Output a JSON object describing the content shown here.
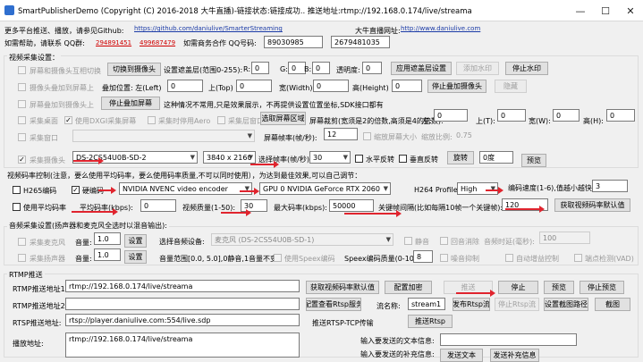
{
  "window": {
    "title": "SmartPublisherDemo  (Copyright (C) 2016-2018 大牛直播)-链接状态:链接成功.. 推送地址:rtmp://192.168.0.174/live/streama"
  },
  "header": {
    "tip": "更多平台推送、播放，请参见Github:",
    "github_url": "https://github.com/daniulive/SmarterStreaming",
    "website_label": "大牛直播网址:",
    "website_url": "http://www.daniulive.com",
    "help_label": "如需帮助，请联系 QQ群:",
    "qq_group1": "294891451",
    "qq_group2": "499687479",
    "biz_label": "如需商务合作 QQ号码:",
    "biz_qq1": "89030985",
    "biz_qq2": "2679481035"
  },
  "video": {
    "section": "视频采集设置：",
    "screen_camera_overlay": "屏幕和摄像头互相切换",
    "switch_camera": "切换到摄像头",
    "bg_color_label": "设置遮盖层(范围0-255):",
    "r": "R:",
    "r_val": "0",
    "g": "G:",
    "g_val": "0",
    "b": "B:",
    "b_val": "0",
    "alpha": "透明度:",
    "alpha_val": "0",
    "apply_cover": "应用遮盖层设置",
    "add_watermark": "添加水印",
    "stop_watermark": "停止水印",
    "camera_over_screen": "摄像头叠加到屏幕上",
    "overlay_pos": "叠加位置: 左(Left)",
    "left_val": "0",
    "top_label": "上(Top)",
    "top_val": "0",
    "width_label": "宽(Width)",
    "width_val": "0",
    "height_label": "高(Height)",
    "height_val": "0",
    "stop_overlay_camera": "停止叠加摄像头",
    "hide": "隐藏",
    "screen_over_camera": "屏幕叠加到摄像头上",
    "stop_overlay_screen": "停止叠加屏幕",
    "tip2": "这种情况不常用,只是效果展示，不再提供设置位置坐标,SDK接口都有",
    "capture_desktop": "采集桌面",
    "use_dxgi": "使用DXGI采集屏幕",
    "disable_aero": "采集时停用Aero",
    "capture_layer": "采集层窗口",
    "select_region": "选取屏幕区域",
    "screen_crop": "屏幕裁剪(宽须是2的倍数,高须是4的倍数):",
    "crop_left": "左:",
    "crop_left_val": "0",
    "crop_top": "上(T):",
    "crop_top_val": "0",
    "crop_w": "宽(W):",
    "crop_w_val": "0",
    "crop_h": "高(H):",
    "crop_h_val": "0",
    "capture_window": "采集窗口",
    "window_sel": "",
    "fps_label": "屏幕帧率(帧/秒):",
    "fps_val": "12",
    "scale_screen": "缩放屏幕大小",
    "scale_ratio": "缩放比例:",
    "scale_val": "0.75",
    "capture_camera": "采集摄像头",
    "camera_name": "DS-2CS54U0B-SD-2",
    "resolution": "3840 x 2160",
    "cam_fps_label": "选择帧率(帧/秒):",
    "cam_fps_val": "30",
    "hflip": "水平反转",
    "vflip": "垂直反转",
    "rotate": "旋转",
    "rotate_val": "0度",
    "preview": "预览"
  },
  "encode": {
    "section": "视频码率控制(注意，要么使用平均码率，要么使用码率质量,不可以同时使用），为达到最佳效果,可以自己调节：",
    "h265": "H265编码",
    "hw_encode": "硬编码",
    "encoder": "NVIDIA NVENC video encoder",
    "gpu": "GPU 0 NVIDIA GeForce RTX 2060",
    "profile_label": "H264 Profile:",
    "profile_val": "High",
    "speed_label": "编码速度(1-6),值越小越快",
    "speed_val": "3",
    "avg_bitrate": "使用平均码率",
    "avg_label": "平均码率(kbps):",
    "avg_val": "0",
    "quality_label": "视频质量(1-50):",
    "quality_val": "30",
    "max_label": "最大码率(kbps):",
    "max_val": "50000",
    "gop_label": "关键帧间隔(比如每隔10帧一个关键帧):",
    "gop_val": "120",
    "get_default": "获取视频码率默认值"
  },
  "audio": {
    "section": "音频采集设置(扬声器和麦克风全选时以混音输出):",
    "capture_speaker": "采集麦克风",
    "gain_label": "音量:",
    "gain_val": "1.0",
    "set": "设置",
    "select_device": "选择音频设备:",
    "device": "麦克风 (DS-2CS54U0B-SD-1)",
    "mute": "静音",
    "echo_cancel": "回音消除",
    "echo_delay": "音频时延(毫秒):",
    "echo_delay_val": "100",
    "capture_loopback": "采集扬声器",
    "gain2_val": "1.0",
    "set2": "设置",
    "vol_range": "音量范围[0.0, 5.0],0静音,1音量不变",
    "use_speex": "使用Speex编码",
    "speex_label": "Speex编码质量(0-10):",
    "speex_val": "8",
    "noise": "噪音抑制",
    "agc": "自动增益控制",
    "vad": "端点检测(VAD)"
  },
  "rtmp": {
    "section": "RTMP推送",
    "url1_label": "RTMP推送地址1:",
    "url1": "rtmp://192.168.0.174/live/streama",
    "get_bitrate": "获取视频码率默认值",
    "encrypt": "配置加密",
    "push": "推送",
    "stop": "停止",
    "preview": "预览",
    "stop_preview": "停止预览",
    "url2_label": "RTMP推送地址2:",
    "url2": "",
    "rtsp_config": "配置查看Rtsp服务",
    "stream_name_label": "流名称:",
    "stream_name": "stream1",
    "publish_rtsp": "发布Rtsp流",
    "stop_rtsp": "停止Rtsp流",
    "set_snapshot": "设置截图路径",
    "snapshot": "截图",
    "rtsp_label": "RTSP推送地址:",
    "rtsp_url": "rtsp://player.daniulive.com:554/live.sdp",
    "push_rtsp_tcp": "推送RTSP-TCP传输",
    "push_rtsp": "推送Rtsp",
    "play_label": "播放地址:",
    "play_url": "rtmp://192.168.0.174/live/streama",
    "text_input_label": "输入要发送的文本信息:",
    "text_label2": "输入要发送的补充信息:",
    "send_text": "发送文本",
    "send_info": "发送补充信息"
  }
}
